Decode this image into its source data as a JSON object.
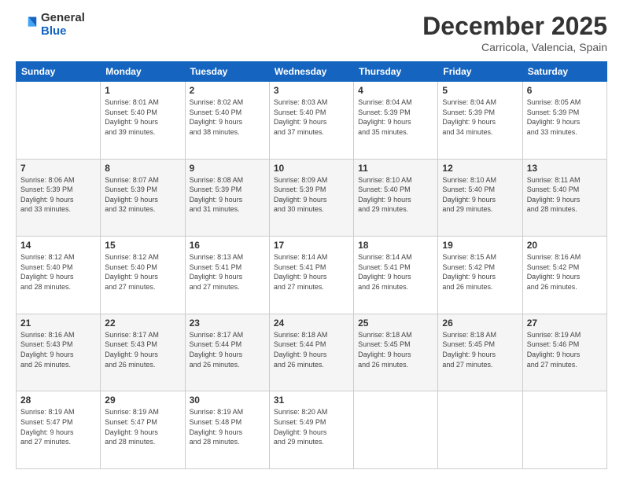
{
  "header": {
    "logo_line1": "General",
    "logo_line2": "Blue",
    "month": "December 2025",
    "location": "Carricola, Valencia, Spain"
  },
  "weekdays": [
    "Sunday",
    "Monday",
    "Tuesday",
    "Wednesday",
    "Thursday",
    "Friday",
    "Saturday"
  ],
  "weeks": [
    [
      {
        "day": "",
        "info": ""
      },
      {
        "day": "1",
        "info": "Sunrise: 8:01 AM\nSunset: 5:40 PM\nDaylight: 9 hours\nand 39 minutes."
      },
      {
        "day": "2",
        "info": "Sunrise: 8:02 AM\nSunset: 5:40 PM\nDaylight: 9 hours\nand 38 minutes."
      },
      {
        "day": "3",
        "info": "Sunrise: 8:03 AM\nSunset: 5:40 PM\nDaylight: 9 hours\nand 37 minutes."
      },
      {
        "day": "4",
        "info": "Sunrise: 8:04 AM\nSunset: 5:39 PM\nDaylight: 9 hours\nand 35 minutes."
      },
      {
        "day": "5",
        "info": "Sunrise: 8:04 AM\nSunset: 5:39 PM\nDaylight: 9 hours\nand 34 minutes."
      },
      {
        "day": "6",
        "info": "Sunrise: 8:05 AM\nSunset: 5:39 PM\nDaylight: 9 hours\nand 33 minutes."
      }
    ],
    [
      {
        "day": "7",
        "info": "Sunrise: 8:06 AM\nSunset: 5:39 PM\nDaylight: 9 hours\nand 33 minutes."
      },
      {
        "day": "8",
        "info": "Sunrise: 8:07 AM\nSunset: 5:39 PM\nDaylight: 9 hours\nand 32 minutes."
      },
      {
        "day": "9",
        "info": "Sunrise: 8:08 AM\nSunset: 5:39 PM\nDaylight: 9 hours\nand 31 minutes."
      },
      {
        "day": "10",
        "info": "Sunrise: 8:09 AM\nSunset: 5:39 PM\nDaylight: 9 hours\nand 30 minutes."
      },
      {
        "day": "11",
        "info": "Sunrise: 8:10 AM\nSunset: 5:40 PM\nDaylight: 9 hours\nand 29 minutes."
      },
      {
        "day": "12",
        "info": "Sunrise: 8:10 AM\nSunset: 5:40 PM\nDaylight: 9 hours\nand 29 minutes."
      },
      {
        "day": "13",
        "info": "Sunrise: 8:11 AM\nSunset: 5:40 PM\nDaylight: 9 hours\nand 28 minutes."
      }
    ],
    [
      {
        "day": "14",
        "info": "Sunrise: 8:12 AM\nSunset: 5:40 PM\nDaylight: 9 hours\nand 28 minutes."
      },
      {
        "day": "15",
        "info": "Sunrise: 8:12 AM\nSunset: 5:40 PM\nDaylight: 9 hours\nand 27 minutes."
      },
      {
        "day": "16",
        "info": "Sunrise: 8:13 AM\nSunset: 5:41 PM\nDaylight: 9 hours\nand 27 minutes."
      },
      {
        "day": "17",
        "info": "Sunrise: 8:14 AM\nSunset: 5:41 PM\nDaylight: 9 hours\nand 27 minutes."
      },
      {
        "day": "18",
        "info": "Sunrise: 8:14 AM\nSunset: 5:41 PM\nDaylight: 9 hours\nand 26 minutes."
      },
      {
        "day": "19",
        "info": "Sunrise: 8:15 AM\nSunset: 5:42 PM\nDaylight: 9 hours\nand 26 minutes."
      },
      {
        "day": "20",
        "info": "Sunrise: 8:16 AM\nSunset: 5:42 PM\nDaylight: 9 hours\nand 26 minutes."
      }
    ],
    [
      {
        "day": "21",
        "info": "Sunrise: 8:16 AM\nSunset: 5:43 PM\nDaylight: 9 hours\nand 26 minutes."
      },
      {
        "day": "22",
        "info": "Sunrise: 8:17 AM\nSunset: 5:43 PM\nDaylight: 9 hours\nand 26 minutes."
      },
      {
        "day": "23",
        "info": "Sunrise: 8:17 AM\nSunset: 5:44 PM\nDaylight: 9 hours\nand 26 minutes."
      },
      {
        "day": "24",
        "info": "Sunrise: 8:18 AM\nSunset: 5:44 PM\nDaylight: 9 hours\nand 26 minutes."
      },
      {
        "day": "25",
        "info": "Sunrise: 8:18 AM\nSunset: 5:45 PM\nDaylight: 9 hours\nand 26 minutes."
      },
      {
        "day": "26",
        "info": "Sunrise: 8:18 AM\nSunset: 5:45 PM\nDaylight: 9 hours\nand 27 minutes."
      },
      {
        "day": "27",
        "info": "Sunrise: 8:19 AM\nSunset: 5:46 PM\nDaylight: 9 hours\nand 27 minutes."
      }
    ],
    [
      {
        "day": "28",
        "info": "Sunrise: 8:19 AM\nSunset: 5:47 PM\nDaylight: 9 hours\nand 27 minutes."
      },
      {
        "day": "29",
        "info": "Sunrise: 8:19 AM\nSunset: 5:47 PM\nDaylight: 9 hours\nand 28 minutes."
      },
      {
        "day": "30",
        "info": "Sunrise: 8:19 AM\nSunset: 5:48 PM\nDaylight: 9 hours\nand 28 minutes."
      },
      {
        "day": "31",
        "info": "Sunrise: 8:20 AM\nSunset: 5:49 PM\nDaylight: 9 hours\nand 29 minutes."
      },
      {
        "day": "",
        "info": ""
      },
      {
        "day": "",
        "info": ""
      },
      {
        "day": "",
        "info": ""
      }
    ]
  ]
}
